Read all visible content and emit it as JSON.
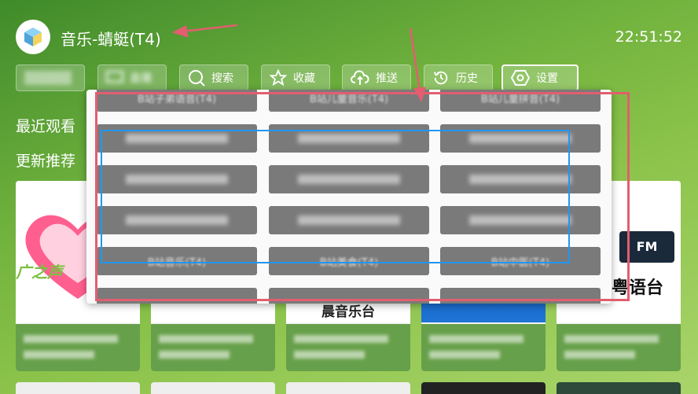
{
  "header": {
    "app_title": "音乐-蜻蜓(T4)",
    "clock": "22:51:52",
    "logo_icon": "cube-icon"
  },
  "toolbar": {
    "items": [
      {
        "label": "",
        "icon": "blurred-icon"
      },
      {
        "label": "直播",
        "icon": "tv-icon"
      },
      {
        "label": "搜索",
        "icon": "search-icon"
      },
      {
        "label": "收藏",
        "icon": "star-icon"
      },
      {
        "label": "推送",
        "icon": "cloud-upload-icon"
      },
      {
        "label": "历史",
        "icon": "history-icon"
      },
      {
        "label": "设置",
        "icon": "hexagon-settings-icon"
      }
    ]
  },
  "sections": {
    "recent": "最近观看",
    "recommend": "更新推荐"
  },
  "popup": {
    "row_top": [
      "B站子弟语音(T4)",
      "B站儿童音乐(T4)",
      "B站儿童拼音(T4)"
    ],
    "row_bottom": [
      "B站音乐(T4)",
      "B站美食(T4)",
      "B站中医(T4)"
    ]
  },
  "cards": {
    "texts": [
      "广之声",
      "粤语台",
      "FM",
      "晨音乐台"
    ]
  },
  "colors": {
    "annotation_red": "#e25e70",
    "annotation_blue": "#2196f3",
    "popup_button": "#7a7a7a"
  }
}
